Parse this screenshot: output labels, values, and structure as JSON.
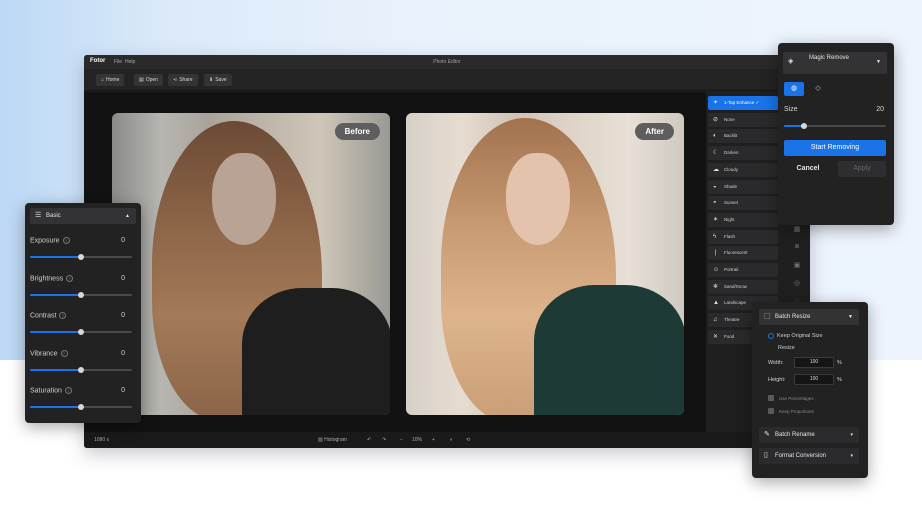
{
  "app": {
    "logo": "Fotor",
    "menu": [
      "File",
      "Help"
    ],
    "document_title": "Photo Editor"
  },
  "toolbar": {
    "home": "Home",
    "open": "Open",
    "share": "Share",
    "save": "Save"
  },
  "labels": {
    "before": "Before",
    "after": "After"
  },
  "effects": {
    "items": [
      {
        "label": "1-Tap Enhance",
        "icon": "magic-wand-icon",
        "active": true
      },
      {
        "label": "None",
        "icon": "none-icon"
      },
      {
        "label": "Backlit",
        "icon": "backlit-icon"
      },
      {
        "label": "Darken",
        "icon": "moon-icon"
      },
      {
        "label": "Cloudy",
        "icon": "cloud-icon"
      },
      {
        "label": "Shade",
        "icon": "shade-icon"
      },
      {
        "label": "Sunset",
        "icon": "sunset-icon"
      },
      {
        "label": "Night",
        "icon": "night-icon"
      },
      {
        "label": "Flash",
        "icon": "flash-icon"
      },
      {
        "label": "Fluorescent",
        "icon": "fluorescent-icon"
      },
      {
        "label": "Portrait",
        "icon": "portrait-icon"
      },
      {
        "label": "Sand/Snow",
        "icon": "snow-icon"
      },
      {
        "label": "Landscape",
        "icon": "landscape-icon"
      },
      {
        "label": "Theatre",
        "icon": "theatre-icon"
      },
      {
        "label": "Food",
        "icon": "food-icon"
      }
    ]
  },
  "statusbar": {
    "size": "1080 x",
    "histogram": "Histogram",
    "zoom": "10%"
  },
  "basic_panel": {
    "title": "Basic",
    "rows": [
      {
        "label": "Exposure",
        "value": "0",
        "level": 0.5
      },
      {
        "label": "Brightness",
        "value": "0",
        "level": 0.5
      },
      {
        "label": "Contrast",
        "value": "0",
        "level": 0.5
      },
      {
        "label": "Vibrance",
        "value": "0",
        "level": 0.5
      },
      {
        "label": "Saturation",
        "value": "0",
        "level": 0.5
      }
    ]
  },
  "magic_panel": {
    "title": "Magic Remove",
    "size_label": "Size",
    "size_value": "20",
    "size_level": 0.2,
    "start": "Start Removing",
    "cancel": "Cancel",
    "apply": "Apply"
  },
  "resize_panel": {
    "title": "Batch Resize",
    "keep_original": "Keep Original Size",
    "resize": "Resize",
    "width_label": "Width:",
    "width_value": "100",
    "height_label": "Height:",
    "height_value": "100",
    "unit": "%",
    "use_percentages": "Use Percentages",
    "keep_proportions": "Keep Proportions",
    "batch_rename": "Batch Rename",
    "format_conversion": "Format Conversion"
  },
  "colors": {
    "accent": "#1a73e8",
    "panel_bg": "#222223",
    "window_bg": "#1f1f20"
  }
}
